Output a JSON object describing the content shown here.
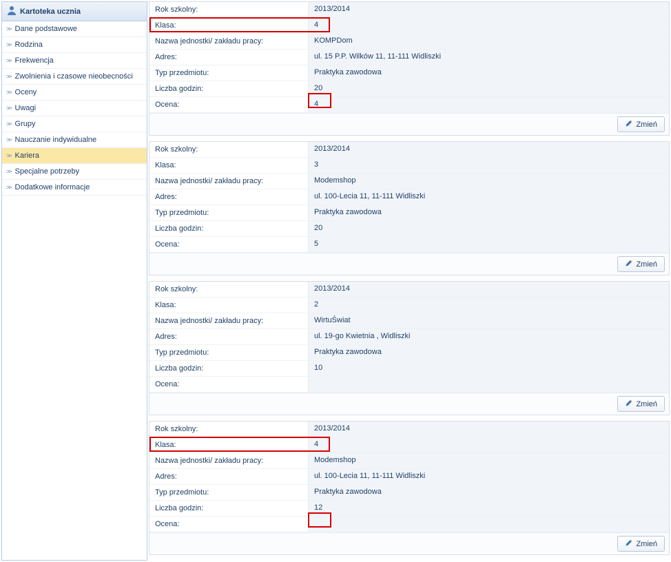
{
  "sidebar": {
    "title": "Kartoteka ucznia",
    "items": [
      {
        "label": "Dane podstawowe",
        "active": false
      },
      {
        "label": "Rodzina",
        "active": false
      },
      {
        "label": "Frekwencja",
        "active": false
      },
      {
        "label": "Zwolnienia i czasowe nieobecności",
        "active": false
      },
      {
        "label": "Oceny",
        "active": false
      },
      {
        "label": "Uwagi",
        "active": false
      },
      {
        "label": "Grupy",
        "active": false
      },
      {
        "label": "Nauczanie indywidualne",
        "active": false
      },
      {
        "label": "Kariera",
        "active": true
      },
      {
        "label": "Specjalne potrzeby",
        "active": false
      },
      {
        "label": "Dodatkowe informacje",
        "active": false
      }
    ]
  },
  "fields": {
    "rok_szkolny": "Rok szkolny:",
    "klasa": "Klasa:",
    "nazwa": "Nazwa jednostki/ zakładu pracy:",
    "adres": "Adres:",
    "typ": "Typ przedmiotu:",
    "liczba": "Liczba godzin:",
    "ocena": "Ocena:",
    "zmien": "Zmień"
  },
  "records": [
    {
      "rok": "2013/2014",
      "klasa": "4",
      "nazwa": "KOMPDom",
      "adres": "ul. 15 P.P. Wilków 11, 11-111 Widliszki",
      "typ": "Praktyka zawodowa",
      "liczba": "20",
      "ocena": "4",
      "highlight_klasa_row": true,
      "highlight_ocena_value": true
    },
    {
      "rok": "2013/2014",
      "klasa": "3",
      "nazwa": "Modemshop",
      "adres": "ul. 100-Lecia 11, 11-111 Widliszki",
      "typ": "Praktyka zawodowa",
      "liczba": "20",
      "ocena": "5"
    },
    {
      "rok": "2013/2014",
      "klasa": "2",
      "nazwa": "WirtuŚwiat",
      "adres": "ul. 19-go Kwietnia , Widliszki",
      "typ": "Praktyka zawodowa",
      "liczba": "10",
      "ocena": ""
    },
    {
      "rok": "2013/2014",
      "klasa": "4",
      "nazwa": "Modemshop",
      "adres": "ul. 100-Lecia 11, 11-111 Widliszki",
      "typ": "Praktyka zawodowa",
      "liczba": "12",
      "ocena": "",
      "highlight_klasa_row": true,
      "highlight_ocena_value": true
    }
  ]
}
